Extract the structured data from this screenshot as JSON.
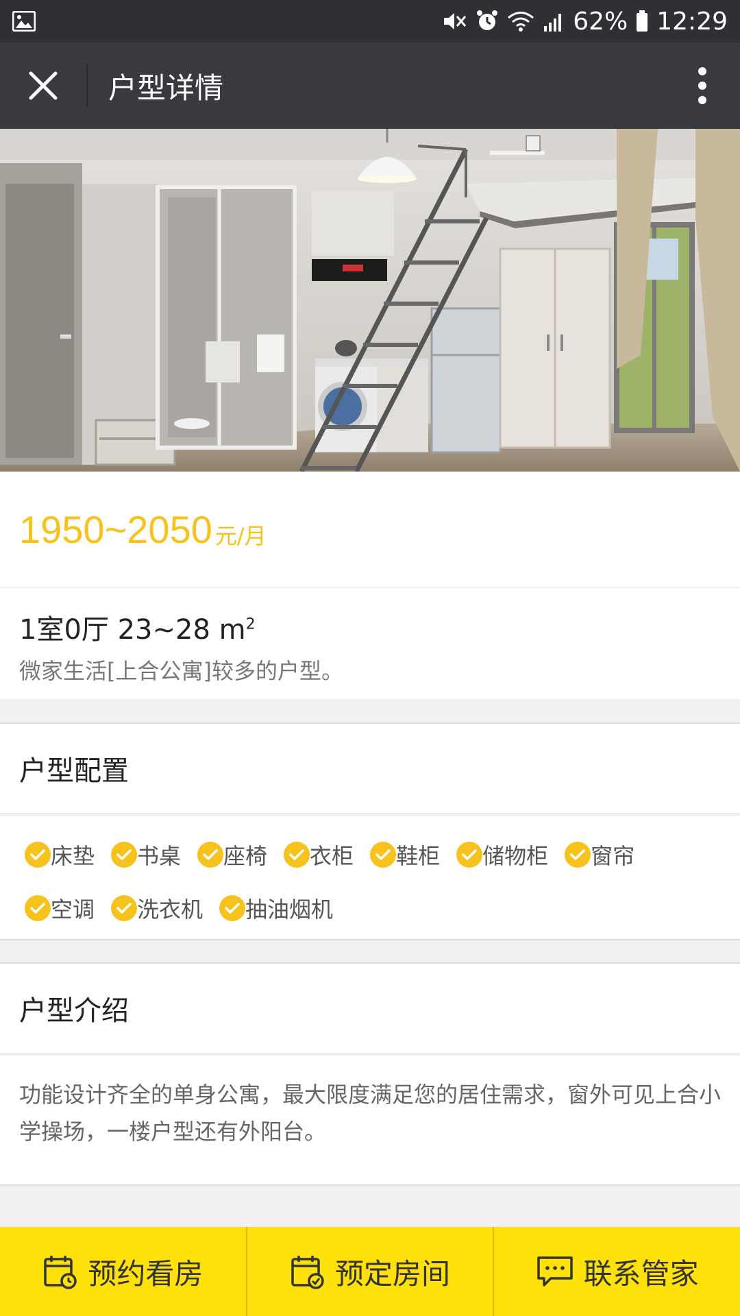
{
  "status_bar": {
    "battery": "62%",
    "time": "12:29"
  },
  "header": {
    "title": "户型详情"
  },
  "price": {
    "range": "1950~2050",
    "unit": "元/月"
  },
  "summary": {
    "layout": "1室0厅 23~28 m",
    "area_superscript": "2",
    "note": "微家生活[上合公寓]较多的户型。"
  },
  "config": {
    "title": "户型配置",
    "items_row1": [
      "床垫",
      "书桌",
      "座椅",
      "衣柜",
      "鞋柜",
      "储物柜",
      "窗帘"
    ],
    "items_row2": [
      "空调",
      "洗衣机",
      "抽油烟机"
    ]
  },
  "intro": {
    "title": "户型介绍",
    "text": "功能设计齐全的单身公寓，最大限度满足您的居住需求，窗外可见上合小学操场，一楼户型还有外阳台。"
  },
  "bottom_bar": {
    "book_viewing": "预约看房",
    "reserve_room": "预定房间",
    "contact_manager": "联系管家"
  },
  "colors": {
    "accent": "#f8c21d",
    "bottom_bar": "#ffe10a",
    "titlebar": "#393a3f"
  }
}
